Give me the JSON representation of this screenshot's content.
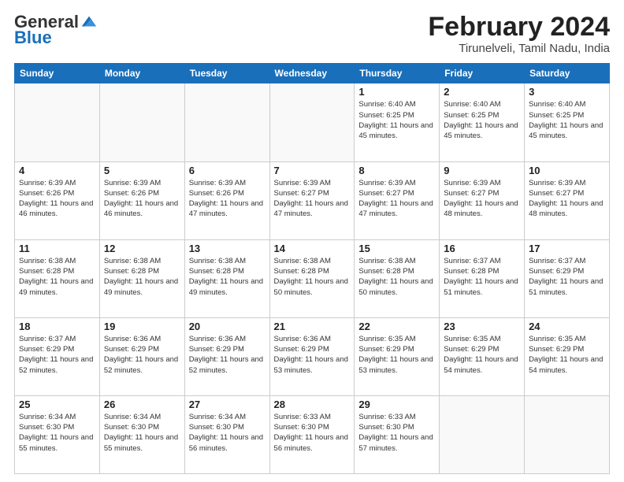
{
  "logo": {
    "general": "General",
    "blue": "Blue"
  },
  "header": {
    "title": "February 2024",
    "subtitle": "Tirunelveli, Tamil Nadu, India"
  },
  "days_of_week": [
    "Sunday",
    "Monday",
    "Tuesday",
    "Wednesday",
    "Thursday",
    "Friday",
    "Saturday"
  ],
  "weeks": [
    [
      {
        "day": "",
        "info": ""
      },
      {
        "day": "",
        "info": ""
      },
      {
        "day": "",
        "info": ""
      },
      {
        "day": "",
        "info": ""
      },
      {
        "day": "1",
        "info": "Sunrise: 6:40 AM\nSunset: 6:25 PM\nDaylight: 11 hours\nand 45 minutes."
      },
      {
        "day": "2",
        "info": "Sunrise: 6:40 AM\nSunset: 6:25 PM\nDaylight: 11 hours\nand 45 minutes."
      },
      {
        "day": "3",
        "info": "Sunrise: 6:40 AM\nSunset: 6:25 PM\nDaylight: 11 hours\nand 45 minutes."
      }
    ],
    [
      {
        "day": "4",
        "info": "Sunrise: 6:39 AM\nSunset: 6:26 PM\nDaylight: 11 hours\nand 46 minutes."
      },
      {
        "day": "5",
        "info": "Sunrise: 6:39 AM\nSunset: 6:26 PM\nDaylight: 11 hours\nand 46 minutes."
      },
      {
        "day": "6",
        "info": "Sunrise: 6:39 AM\nSunset: 6:26 PM\nDaylight: 11 hours\nand 47 minutes."
      },
      {
        "day": "7",
        "info": "Sunrise: 6:39 AM\nSunset: 6:27 PM\nDaylight: 11 hours\nand 47 minutes."
      },
      {
        "day": "8",
        "info": "Sunrise: 6:39 AM\nSunset: 6:27 PM\nDaylight: 11 hours\nand 47 minutes."
      },
      {
        "day": "9",
        "info": "Sunrise: 6:39 AM\nSunset: 6:27 PM\nDaylight: 11 hours\nand 48 minutes."
      },
      {
        "day": "10",
        "info": "Sunrise: 6:39 AM\nSunset: 6:27 PM\nDaylight: 11 hours\nand 48 minutes."
      }
    ],
    [
      {
        "day": "11",
        "info": "Sunrise: 6:38 AM\nSunset: 6:28 PM\nDaylight: 11 hours\nand 49 minutes."
      },
      {
        "day": "12",
        "info": "Sunrise: 6:38 AM\nSunset: 6:28 PM\nDaylight: 11 hours\nand 49 minutes."
      },
      {
        "day": "13",
        "info": "Sunrise: 6:38 AM\nSunset: 6:28 PM\nDaylight: 11 hours\nand 49 minutes."
      },
      {
        "day": "14",
        "info": "Sunrise: 6:38 AM\nSunset: 6:28 PM\nDaylight: 11 hours\nand 50 minutes."
      },
      {
        "day": "15",
        "info": "Sunrise: 6:38 AM\nSunset: 6:28 PM\nDaylight: 11 hours\nand 50 minutes."
      },
      {
        "day": "16",
        "info": "Sunrise: 6:37 AM\nSunset: 6:28 PM\nDaylight: 11 hours\nand 51 minutes."
      },
      {
        "day": "17",
        "info": "Sunrise: 6:37 AM\nSunset: 6:29 PM\nDaylight: 11 hours\nand 51 minutes."
      }
    ],
    [
      {
        "day": "18",
        "info": "Sunrise: 6:37 AM\nSunset: 6:29 PM\nDaylight: 11 hours\nand 52 minutes."
      },
      {
        "day": "19",
        "info": "Sunrise: 6:36 AM\nSunset: 6:29 PM\nDaylight: 11 hours\nand 52 minutes."
      },
      {
        "day": "20",
        "info": "Sunrise: 6:36 AM\nSunset: 6:29 PM\nDaylight: 11 hours\nand 52 minutes."
      },
      {
        "day": "21",
        "info": "Sunrise: 6:36 AM\nSunset: 6:29 PM\nDaylight: 11 hours\nand 53 minutes."
      },
      {
        "day": "22",
        "info": "Sunrise: 6:35 AM\nSunset: 6:29 PM\nDaylight: 11 hours\nand 53 minutes."
      },
      {
        "day": "23",
        "info": "Sunrise: 6:35 AM\nSunset: 6:29 PM\nDaylight: 11 hours\nand 54 minutes."
      },
      {
        "day": "24",
        "info": "Sunrise: 6:35 AM\nSunset: 6:29 PM\nDaylight: 11 hours\nand 54 minutes."
      }
    ],
    [
      {
        "day": "25",
        "info": "Sunrise: 6:34 AM\nSunset: 6:30 PM\nDaylight: 11 hours\nand 55 minutes."
      },
      {
        "day": "26",
        "info": "Sunrise: 6:34 AM\nSunset: 6:30 PM\nDaylight: 11 hours\nand 55 minutes."
      },
      {
        "day": "27",
        "info": "Sunrise: 6:34 AM\nSunset: 6:30 PM\nDaylight: 11 hours\nand 56 minutes."
      },
      {
        "day": "28",
        "info": "Sunrise: 6:33 AM\nSunset: 6:30 PM\nDaylight: 11 hours\nand 56 minutes."
      },
      {
        "day": "29",
        "info": "Sunrise: 6:33 AM\nSunset: 6:30 PM\nDaylight: 11 hours\nand 57 minutes."
      },
      {
        "day": "",
        "info": ""
      },
      {
        "day": "",
        "info": ""
      }
    ]
  ]
}
